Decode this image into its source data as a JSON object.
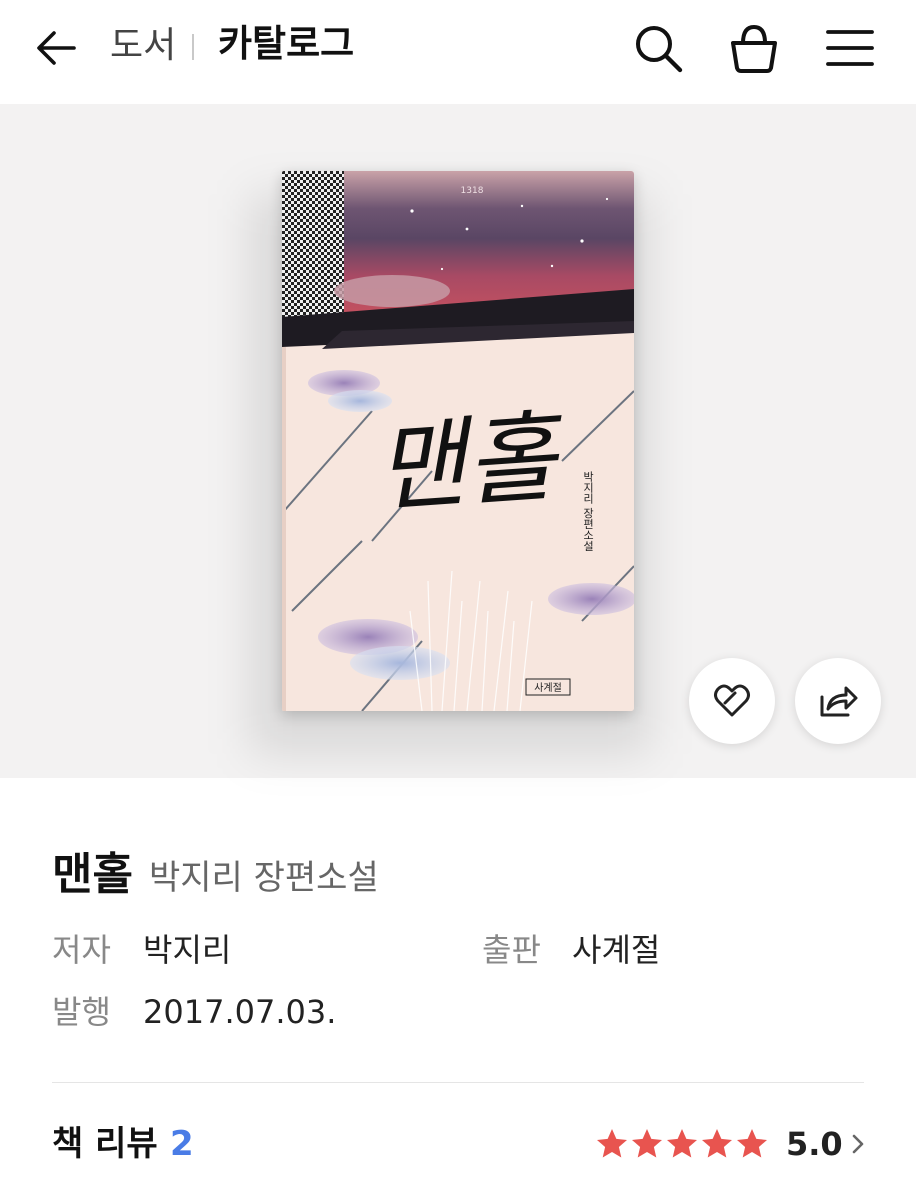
{
  "header": {
    "back_icon": "arrow-left-icon",
    "breadcrumb_parent": "도서",
    "breadcrumb_current": "카탈로그",
    "search_icon": "search-icon",
    "bag_icon": "shopping-bag-icon",
    "menu_icon": "hamburger-menu-icon"
  },
  "hero": {
    "cover": {
      "title_text": "맨홀",
      "author_line": "박지리 장편소설",
      "publisher_logo": "사계절",
      "series_mark": "1318"
    },
    "like_icon": "heart-icon",
    "share_icon": "share-icon"
  },
  "book": {
    "title": "맨홀",
    "subtitle": "박지리 장편소설",
    "author_label": "저자",
    "author": "박지리",
    "publisher_label": "출판",
    "publisher": "사계절",
    "published_label": "발행",
    "published": "2017.07.03."
  },
  "review": {
    "label": "책 리뷰",
    "count": "2",
    "rating": "5.0",
    "stars_filled": 5,
    "star_color": "#e8544f",
    "count_color": "#4a7ce6"
  }
}
